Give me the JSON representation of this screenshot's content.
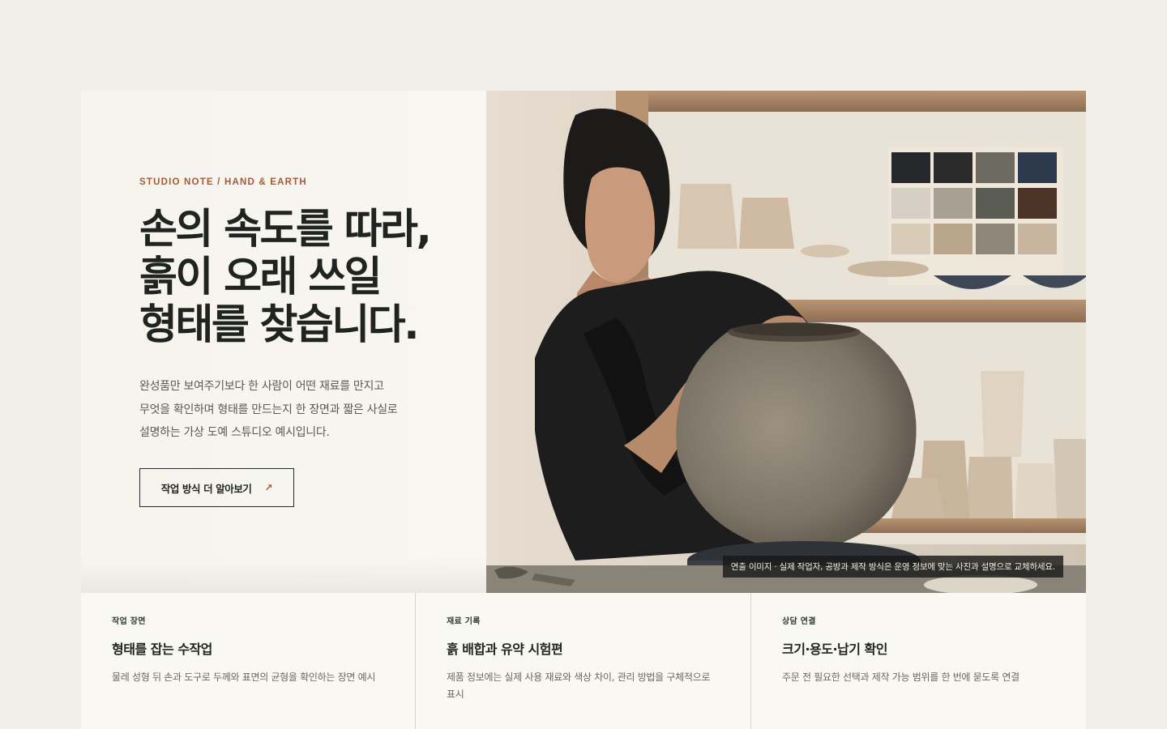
{
  "hero": {
    "eyebrow": "STUDIO NOTE / HAND & EARTH",
    "headline_lines": [
      "손의 속도를 따라,",
      "흙이 오래 쓰일",
      "형태를 찾습니다."
    ],
    "lead_lines": [
      "완성품만 보여주기보다 한 사람이 어떤 재료를 만지고",
      "무엇을 확인하며 형태를 만드는지 한 장면과 짧은 사실로",
      "설명하는 가상 도예 스튜디오 예시입니다."
    ],
    "cta_label": "작업 방식 더 알아보기",
    "cta_icon": "arrow-up-right-icon",
    "photo_caption": "연출 이미지 · 실제 작업자, 공방과 제작 방식은 운영 정보에 맞는 사진과 설명으로 교체하세요."
  },
  "cards": [
    {
      "kicker": "작업 장면",
      "title": "형태를 잡는 수작업",
      "desc": "물레 성형 뒤 손과 도구로 두께와 표면의 균형을 확인하는 장면 예시"
    },
    {
      "kicker": "재료 기록",
      "title": "흙 배합과 유약 시험편",
      "desc": "제품 정보에는 실제 사용 재료와 색상 차이, 관리 방법을 구체적으로 표시"
    },
    {
      "kicker": "상담 연결",
      "title": "크기·용도·납기 확인",
      "desc": "주문 전 필요한 선택과 제작 가능 범위를 한 번에 묻도록 연결"
    }
  ],
  "colors": {
    "accent": "#a15a3a",
    "ink": "#1f2421",
    "page_bg": "#f2eee8"
  }
}
